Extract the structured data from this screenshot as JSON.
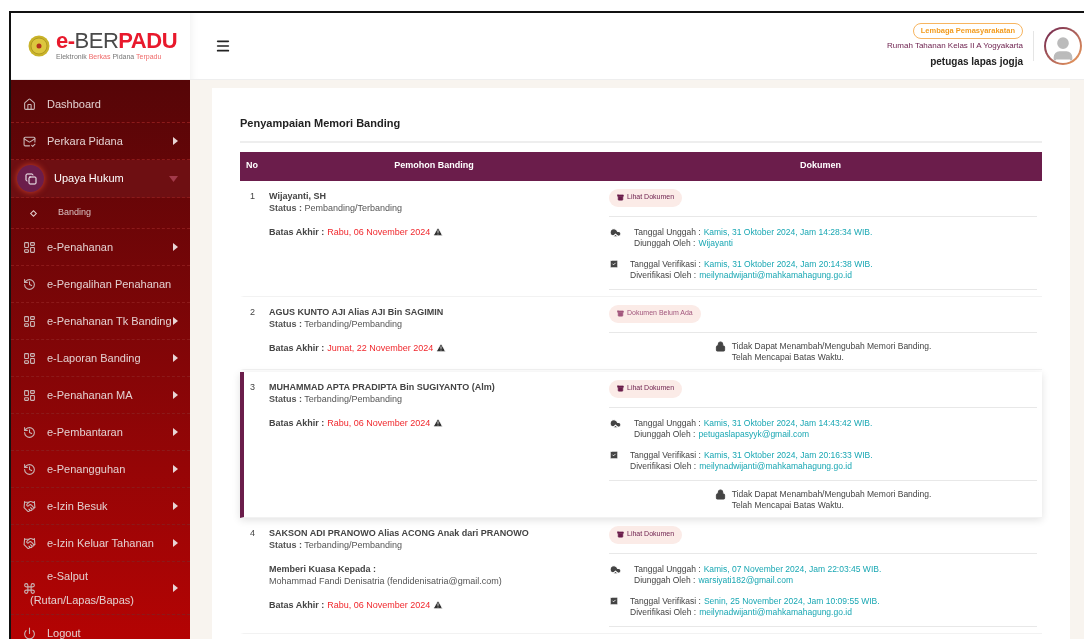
{
  "logo": {
    "title_parts": [
      {
        "text": "e-",
        "accent": true
      },
      {
        "text": "BER",
        "accent": false
      },
      {
        "text": "PADU",
        "accent": true
      }
    ],
    "subtitle_parts": [
      {
        "text": "Elektronik",
        "accent": false
      },
      {
        "text": "Berkas",
        "accent": true
      },
      {
        "text": "Pidana",
        "accent": false
      },
      {
        "text": "Terpadu",
        "accent": true
      }
    ]
  },
  "user": {
    "badge": "Lembaga Pemasyarakatan",
    "office": "Rumah Tahanan Kelas II A Yogyakarta",
    "name": "petugas lapas jogja"
  },
  "sidebar": {
    "items": [
      {
        "label": "Dashboard",
        "selected": false
      },
      {
        "label": "Perkara Pidana",
        "selected": false,
        "expanded": false
      },
      {
        "label": "Upaya Hukum",
        "selected": true,
        "expanded": true,
        "children": [
          {
            "label": "Banding",
            "selected": false
          }
        ]
      },
      {
        "label": "e-Penahanan",
        "selected": false,
        "expanded": false
      },
      {
        "label": "e-Pengalihan Penahanan",
        "selected": false
      },
      {
        "label": "e-Penahanan Tk Banding",
        "selected": false,
        "expanded": false
      },
      {
        "label": "e-Laporan Banding",
        "selected": false,
        "expanded": false
      },
      {
        "label": "e-Penahanan MA",
        "selected": false,
        "expanded": false
      },
      {
        "label": "e-Pembantaran",
        "selected": false,
        "expanded": false
      },
      {
        "label": "e-Penangguhan",
        "selected": false,
        "expanded": false
      },
      {
        "label": "e-Izin Besuk",
        "selected": false,
        "expanded": false
      },
      {
        "label": "e-Izin Keluar Tahanan",
        "selected": false,
        "expanded": false
      },
      {
        "label": "e-Salput",
        "sublabel": "(Rutan/Lapas/Bapas)",
        "selected": false,
        "expanded": false
      },
      {
        "label": "Logout",
        "selected": false
      }
    ]
  },
  "page_title": "Penyampaian Memori Banding",
  "table": {
    "columns": [
      "No",
      "Pemohon Banding",
      "Dokumen"
    ],
    "rows": [
      {
        "no": "1",
        "name": "Wijayanti, SH",
        "status": "**Status :** Pembanding/Terbanding",
        "selected": false,
        "deadline": {
          "label": "Batas Akhir :",
          "value": "Rabu, 06 November 2024"
        },
        "document_button": {
          "label": "Lihat Dokumen",
          "kind": "available"
        },
        "upload": {
          "date_label": "Tanggal Unggah :",
          "date": "Kamis, 31 Oktober 2024, Jam 14:28:34 WIB.",
          "by_label": "Diunggah Oleh :",
          "by": "Wijayanti"
        },
        "verification": {
          "date_label": "Tanggal Verifikasi :",
          "date": "Kamis, 31 Oktober 2024, Jam 20:14:38 WIB.",
          "by_label": "Diverifikasi Oleh :",
          "by": "meilynadwijanti@mahkamahagung.go.id"
        }
      },
      {
        "no": "2",
        "name": "AGUS KUNTO AJI Alias AJI Bin SAGIMIN",
        "status": "**Status :** Terbanding/Pembanding",
        "selected": false,
        "deadline": {
          "label": "Batas Akhir :",
          "value": "Jumat, 22 November 2024"
        },
        "document_button": {
          "label": "Dokumen Belum Ada",
          "kind": "missing"
        },
        "notice": [
          "Tidak Dapat Menambah/Mengubah Memori Banding.",
          "Telah Mencapai Batas Waktu."
        ]
      },
      {
        "no": "3",
        "name": "MUHAMMAD APTA PRADIPTA Bin SUGIYANTO (Alm)",
        "status": "**Status :** Terbanding/Pembanding",
        "selected": true,
        "deadline": {
          "label": "Batas Akhir :",
          "value": "Rabu, 06 November 2024"
        },
        "document_button": {
          "label": "Lihat Dokumen",
          "kind": "available"
        },
        "upload": {
          "date_label": "Tanggal Unggah :",
          "date": "Kamis, 31 Oktober 2024, Jam 14:43:42 WIB.",
          "by_label": "Diunggah Oleh :",
          "by": "petugaslapasyyk@gmail.com"
        },
        "verification": {
          "date_label": "Tanggal Verifikasi :",
          "date": "Kamis, 31 Oktober 2024, Jam 20:16:33 WIB.",
          "by_label": "Diverifikasi Oleh :",
          "by": "meilynadwijanti@mahkamahagung.go.id"
        },
        "notice": [
          "Tidak Dapat Menambah/Mengubah Memori Banding.",
          "Telah Mencapai Batas Waktu."
        ]
      },
      {
        "no": "4",
        "name": "SAKSON ADI PRANOWO Alias ACONG Anak dari PRANOWO",
        "status": "**Status :** Terbanding/Pembanding",
        "selected": false,
        "proxy": {
          "label": "Memberi Kuasa Kepada :",
          "value": "Mohammad Fandi Denisatria (fendidenisatria@gmail.com)"
        },
        "deadline": {
          "label": "Batas Akhir :",
          "value": "Rabu, 06 November 2024"
        },
        "document_button": {
          "label": "Lihat Dokumen",
          "kind": "available"
        },
        "upload": {
          "date_label": "Tanggal Unggah :",
          "date": "Kamis, 07 November 2024, Jam 22:03:45 WIB.",
          "by_label": "Diunggah Oleh :",
          "by": "warsiyati182@gmail.com"
        },
        "verification": {
          "date_label": "Tanggal Verifikasi :",
          "date": "Senin, 25 November 2024, Jam 10:09:55 WIB.",
          "by_label": "Diverifikasi Oleh :",
          "by": "meilynadwijanti@mahkamahagung.go.id"
        }
      }
    ]
  }
}
